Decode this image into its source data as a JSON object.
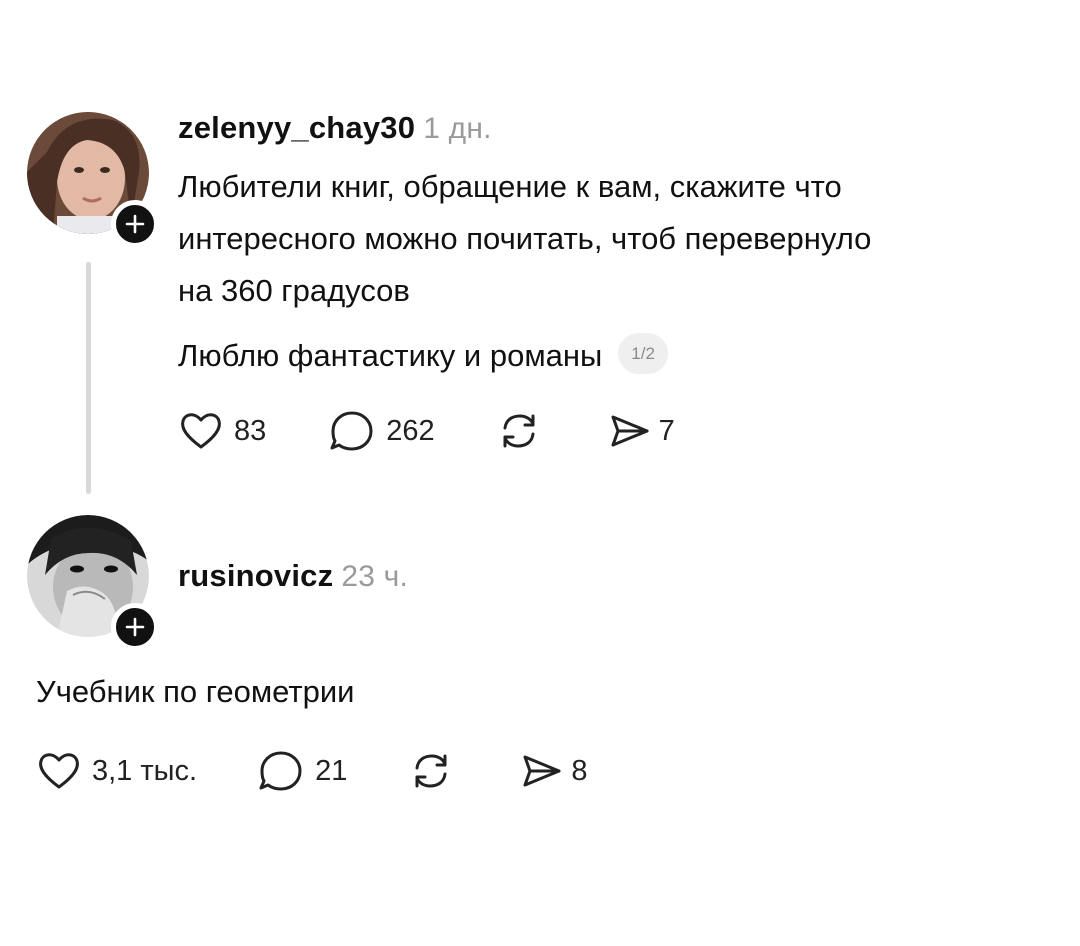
{
  "posts": [
    {
      "username": "zelenyy_chay30",
      "timestamp": "1 дн.",
      "text_lines": [
        "Любители книг, обращение к вам, скажите что",
        "интересного можно почитать, чтоб перевернуло",
        "на 360 градусов"
      ],
      "text_second": "Люблю фантастику и романы",
      "page_indicator": "1/2",
      "likes": "83",
      "comments": "262",
      "shares": "7"
    },
    {
      "username": "rusinovicz",
      "timestamp": "23 ч.",
      "text": "Учебник по геометрии",
      "likes": "3,1 тыс.",
      "comments": "21",
      "shares": "8"
    }
  ],
  "icons": {
    "like": "heart-icon",
    "comment": "comment-bubble-icon",
    "repost": "repost-icon",
    "share": "send-icon",
    "follow": "plus-icon"
  },
  "colors": {
    "text": "#111111",
    "muted": "#9a9a9a",
    "thread_line": "#d9d9d9",
    "pill_bg": "#efefef"
  }
}
